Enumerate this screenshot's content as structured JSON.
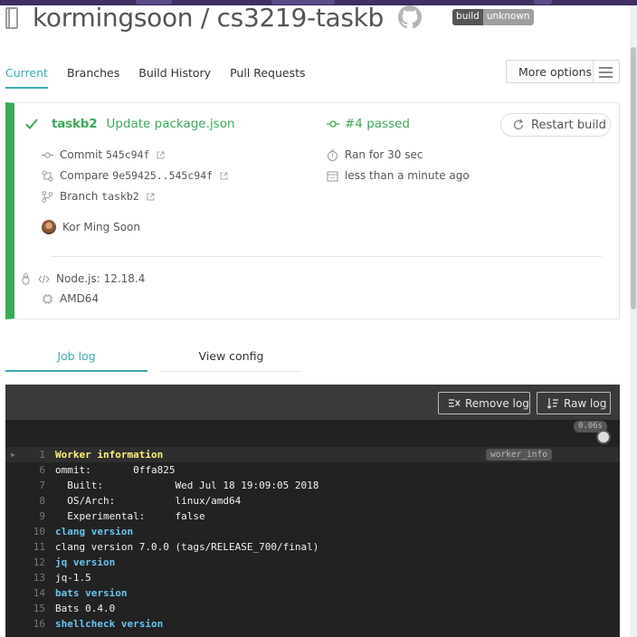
{
  "repo": {
    "title": "kormingsoon / cs3219-taskb",
    "badge_left": "build",
    "badge_right": "unknown"
  },
  "tabs": [
    {
      "label": "Current",
      "active": true
    },
    {
      "label": "Branches",
      "active": false
    },
    {
      "label": "Build History",
      "active": false
    },
    {
      "label": "Pull Requests",
      "active": false
    }
  ],
  "more_options": {
    "label": "More options"
  },
  "build": {
    "status_color": "#39aa56",
    "branch": "taskb2",
    "commit_message": "Update package.json",
    "build_number": "#4 passed",
    "restart_label": "Restart build",
    "commit": {
      "label": "Commit",
      "value": "545c94f"
    },
    "compare": {
      "label": "Compare",
      "value": "9e59425..545c94f"
    },
    "branch_row": {
      "label": "Branch",
      "value": "taskb2"
    },
    "duration": "Ran for 30 sec",
    "finished": "less than a minute ago",
    "author": "Kor Ming Soon",
    "language": "Node.js: 12.18.4",
    "arch": "AMD64"
  },
  "job_tabs": {
    "job_log": "Job log",
    "view_config": "View config"
  },
  "log": {
    "remove_label": "Remove log",
    "raw_label": "Raw log",
    "timer": "0.06s",
    "fold_tag": "worker_info",
    "lines": [
      {
        "n": "1",
        "text": "Worker information",
        "style": "yellow",
        "fold": true
      },
      {
        "n": "6",
        "text": "ommit:       0ffa825",
        "style": "plain"
      },
      {
        "n": "7",
        "text": "  Built:            Wed Jul 18 19:09:05 2018",
        "style": "plain"
      },
      {
        "n": "8",
        "text": "  OS/Arch:          linux/amd64",
        "style": "plain"
      },
      {
        "n": "9",
        "text": "  Experimental:     false",
        "style": "plain"
      },
      {
        "n": "10",
        "text": "clang version",
        "style": "blue"
      },
      {
        "n": "11",
        "text": "clang version 7.0.0 (tags/RELEASE_700/final)",
        "style": "plain"
      },
      {
        "n": "12",
        "text": "jq version",
        "style": "blue"
      },
      {
        "n": "13",
        "text": "jq-1.5",
        "style": "plain"
      },
      {
        "n": "14",
        "text": "bats version",
        "style": "blue"
      },
      {
        "n": "15",
        "text": "Bats 0.4.0",
        "style": "plain"
      },
      {
        "n": "16",
        "text": "shellcheck version",
        "style": "blue"
      }
    ]
  }
}
